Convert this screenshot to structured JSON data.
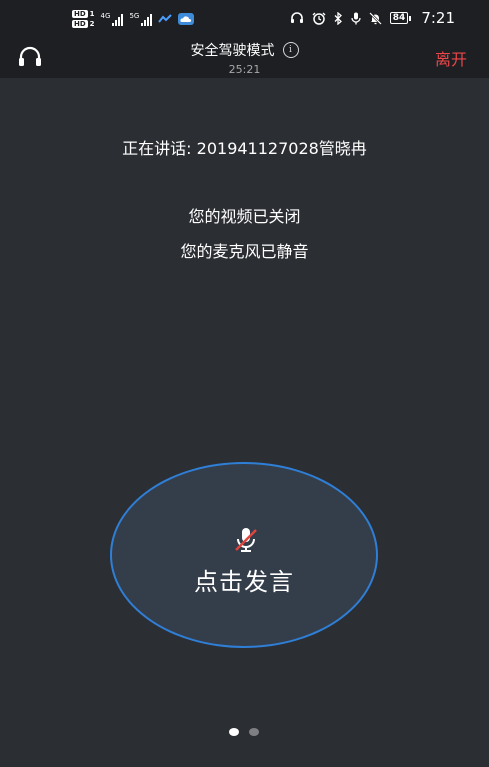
{
  "status_bar": {
    "hd1": "HD",
    "hd1_num": "1",
    "hd2": "HD",
    "hd2_num": "2",
    "net1": "4G",
    "net2": "5G",
    "battery": "84",
    "time": "7:21"
  },
  "header": {
    "title": "安全驾驶模式",
    "timer": "25:21",
    "leave_label": "离开",
    "info_symbol": "i"
  },
  "main": {
    "speaking": "正在讲话: 201941127028管晓冉",
    "video_status": "您的视频已关闭",
    "mic_status": "您的麦克风已静音"
  },
  "talk_button": {
    "label": "点击发言"
  },
  "pager": {
    "count": 2,
    "active_index": 0
  },
  "colors": {
    "background": "#2b2e33",
    "bar": "#1e1f22",
    "leave": "#e9474a",
    "button_border": "#2f7fd7",
    "button_fill": "#343d4a",
    "muted_slash": "#e0453e"
  }
}
